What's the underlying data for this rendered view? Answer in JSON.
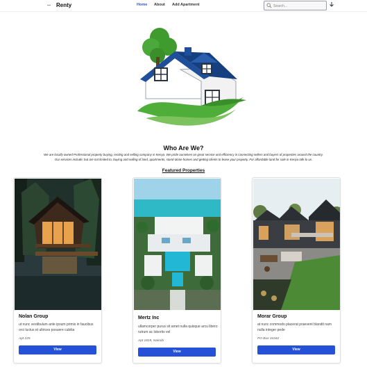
{
  "navbar": {
    "brand": "Renty",
    "links": [
      {
        "label": "Home",
        "active": true
      },
      {
        "label": "About",
        "active": false
      },
      {
        "label": "Add Apartment",
        "active": false
      }
    ],
    "search_placeholder": "Search..."
  },
  "about": {
    "title": "Who Are We?",
    "line1": "We are locally owned Professional property buying, renting and selling company in Kenya. We pride ourselves on great service and efficiency in connecting sellers and buyers of properties around the country.",
    "line2": "Our services include; but are not limited to, buying and selling of land, apartments, stand-alone homes and getting clients to lease your property. For affordable land for sale in Kenya talk to us."
  },
  "featured": {
    "title": "Featured Properties",
    "properties": [
      {
        "name": "Nolan Group",
        "description": "ut nunc vestibulum ante ipsum primis in faucibus orci luctus et ultrices posuere cubilia",
        "address": "Apt 225",
        "button": "View"
      },
      {
        "name": "Mertz Inc",
        "description": "ullamcorper purus sit amet nulla quisque arcu libero rutrum ac lobortis vel",
        "address": "Apt 1819, Nairobi",
        "button": "View"
      },
      {
        "name": "Morar Group",
        "description": "at nunc commodo placerat praesent blandit nam nulla integer pede",
        "address": "PO Box 34342",
        "button": "View"
      }
    ]
  },
  "colors": {
    "accent": "#2451d6",
    "nav_active": "#2a57c9",
    "logo_blue": "#1f4f9a",
    "logo_green": "#4fae3a"
  }
}
